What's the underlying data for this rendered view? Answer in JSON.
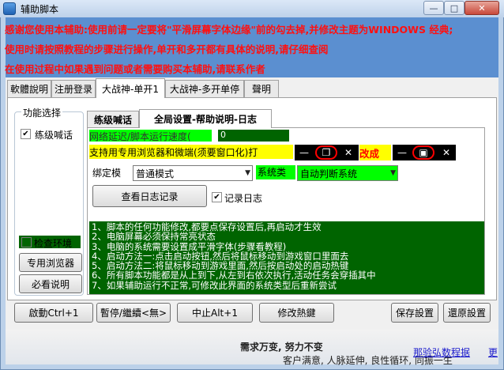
{
  "window": {
    "title": "辅助脚本"
  },
  "banner": {
    "lines": [
      "感谢您使用本辅助:使用前请一定要将\"平滑屏幕字体边缘\"前的勾去掉,并修改主题为WINDOWS 经典;",
      "使用时请按照教程的步骤进行操作,单开和多开都有具体的说明,请仔细查阅",
      "在使用过程中如果遇到问题或者需要购买本辅助,请联系作者"
    ]
  },
  "tabs": [
    "軟體說明",
    "注册登录",
    "大战神-单开1",
    "大战神-多开单停",
    "聲明"
  ],
  "left_group": {
    "title": "功能选择",
    "level_call_label": "练级喊话",
    "level_call_checked": true,
    "check_env_label": "检查环境",
    "browser_button": "专用浏览器",
    "guide_button": "必看说明"
  },
  "inner_tabs": [
    "练级喊话",
    "全局设置-帮助说明-日志"
  ],
  "settings": {
    "latency_label": "网络延迟/脚本运行速度(",
    "latency_value": "0",
    "support_label": "支持用专用浏览器和微端(须要窗口化)打",
    "change_label": "改成",
    "mode_label": "绑定模",
    "mode_value": "普通模式",
    "sysclass_label": "系统类",
    "sysclass_value": "自动判断系统",
    "view_log_button": "查看日志记录",
    "log_label": "记录日志",
    "log_checked": true
  },
  "instructions": [
    "1、脚本的任何功能修改,都要点保存设置后,再启动才生效",
    "2、电脑屏幕必须保持常亮状态",
    "3、电脑的系统需要设置成平滑字体(步骤看教程)",
    "4、启动方法一:点击启动按钮,然后将鼠标移动到游戏窗口里面去",
    "5、启动方法二:将鼠标移动到游戏里面,然后按启动处的启动热键",
    "6、所有脚本功能都是从上到下,从左到右依次执行,活动任务会穿插其中",
    "7、如果辅助运行不正常,可修改此界面的系统类型后重新尝试"
  ],
  "bottom_buttons": {
    "start": "啟動Ctrl+1",
    "pause": "暫停/繼續<無>",
    "stop": "中止Alt+1",
    "hotkey": "修改熱鍵",
    "save": "保存設置",
    "restore": "還原設置"
  },
  "status": {
    "slogan1": "需求万变, 努力不变",
    "slogan2": "客户满意, 人脉延伸, 良性循环, 同振一生",
    "link": "那验弘数程据",
    "link_suffix": "更"
  },
  "colors": {
    "banner_bg": "#5b8fd0",
    "banner_text": "#ff1010",
    "green_dark": "#006400",
    "green_bright": "#00ff00",
    "yellow": "#ffff00"
  }
}
